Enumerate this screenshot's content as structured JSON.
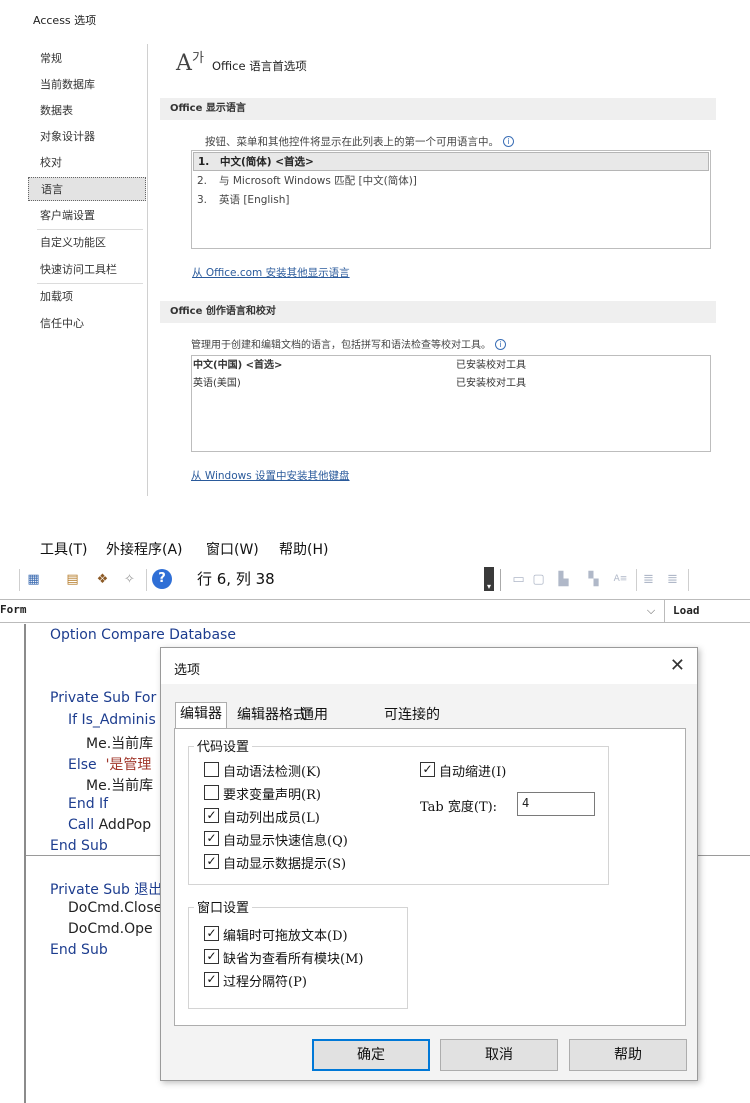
{
  "access_options": {
    "title": "Access 选项",
    "sidebar": [
      {
        "label": "常规",
        "active": false
      },
      {
        "label": "当前数据库",
        "active": false
      },
      {
        "label": "数据表",
        "active": false
      },
      {
        "label": "对象设计器",
        "active": false
      },
      {
        "label": "校对",
        "active": false
      },
      {
        "label": "语言",
        "active": true
      },
      {
        "label": "客户端设置",
        "active": false
      },
      {
        "label": "自定义功能区",
        "active": false
      },
      {
        "label": "快速访问工具栏",
        "active": false
      },
      {
        "label": "加载项",
        "active": false
      },
      {
        "label": "信任中心",
        "active": false
      }
    ],
    "heading": "Office 语言首选项",
    "heading_icon_glyph": "A",
    "heading_icon_small": "가",
    "display_section": {
      "header": "Office 显示语言",
      "description": "按钮、菜单和其他控件将显示在此列表上的第一个可用语言中。",
      "languages": [
        {
          "num": "1.",
          "label": "中文(简体) <首选>",
          "selected": true
        },
        {
          "num": "2.",
          "label": "与 Microsoft Windows 匹配 [中文(简体)]",
          "selected": false
        },
        {
          "num": "3.",
          "label": "英语 [English]",
          "selected": false
        }
      ],
      "install_link": "从 Office.com 安装其他显示语言"
    },
    "authoring_section": {
      "header": "Office 创作语言和校对",
      "description": "管理用于创建和编辑文档的语言，包括拼写和语法检查等校对工具。",
      "languages": [
        {
          "label": "中文(中国) <首选>",
          "status": "已安装校对工具",
          "bold": true
        },
        {
          "label": "英语(美国)",
          "status": "已安装校对工具",
          "bold": false
        }
      ],
      "install_link": "从 Windows 设置中安装其他键盘"
    }
  },
  "vba_editor": {
    "menu": [
      "工具(T)",
      "外接程序(A)",
      "窗口(W)",
      "帮助(H)"
    ],
    "position": "行 6, 列 38",
    "object_combo": "Form",
    "proc_combo": "Load",
    "code": {
      "option_line": "Option Compare Database",
      "sub1": "Private Sub For",
      "if_line": "If Is_Adminis",
      "me1": "Me.当前库",
      "else_kw": "Else",
      "else_str": "'是管理",
      "me2": "Me.当前库",
      "end_if": "End If",
      "call_kw": "Call",
      "call_rest": "AddPop",
      "end_sub1": "End Sub",
      "sub2": "Private Sub 退出",
      "docmd1": "DoCmd.Close",
      "docmd2": "DoCmd.Ope",
      "end_sub2": "End Sub"
    }
  },
  "options_dialog": {
    "title": "选项",
    "close_glyph": "✕",
    "tabs": [
      {
        "label": "编辑器",
        "active": true
      },
      {
        "label": "编辑器格式",
        "active": false
      },
      {
        "label": "通用",
        "active": false
      },
      {
        "label": "可连接的",
        "active": false
      }
    ],
    "code_settings": {
      "title": "代码设置",
      "left_options": [
        {
          "label": "自动语法检测(K)",
          "checked": false
        },
        {
          "label": "要求变量声明(R)",
          "checked": false
        },
        {
          "label": "自动列出成员(L)",
          "checked": true
        },
        {
          "label": "自动显示快速信息(Q)",
          "checked": true
        },
        {
          "label": "自动显示数据提示(S)",
          "checked": true
        }
      ],
      "auto_indent": {
        "label": "自动缩进(I)",
        "checked": true
      },
      "tab_width_label": "Tab 宽度(T):",
      "tab_width_value": "4"
    },
    "window_settings": {
      "title": "窗口设置",
      "options": [
        {
          "label": "编辑时可拖放文本(D)",
          "checked": true
        },
        {
          "label": "缺省为查看所有模块(M)",
          "checked": true
        },
        {
          "label": "过程分隔符(P)",
          "checked": true
        }
      ]
    },
    "buttons": {
      "ok": "确定",
      "cancel": "取消",
      "help": "帮助"
    }
  }
}
